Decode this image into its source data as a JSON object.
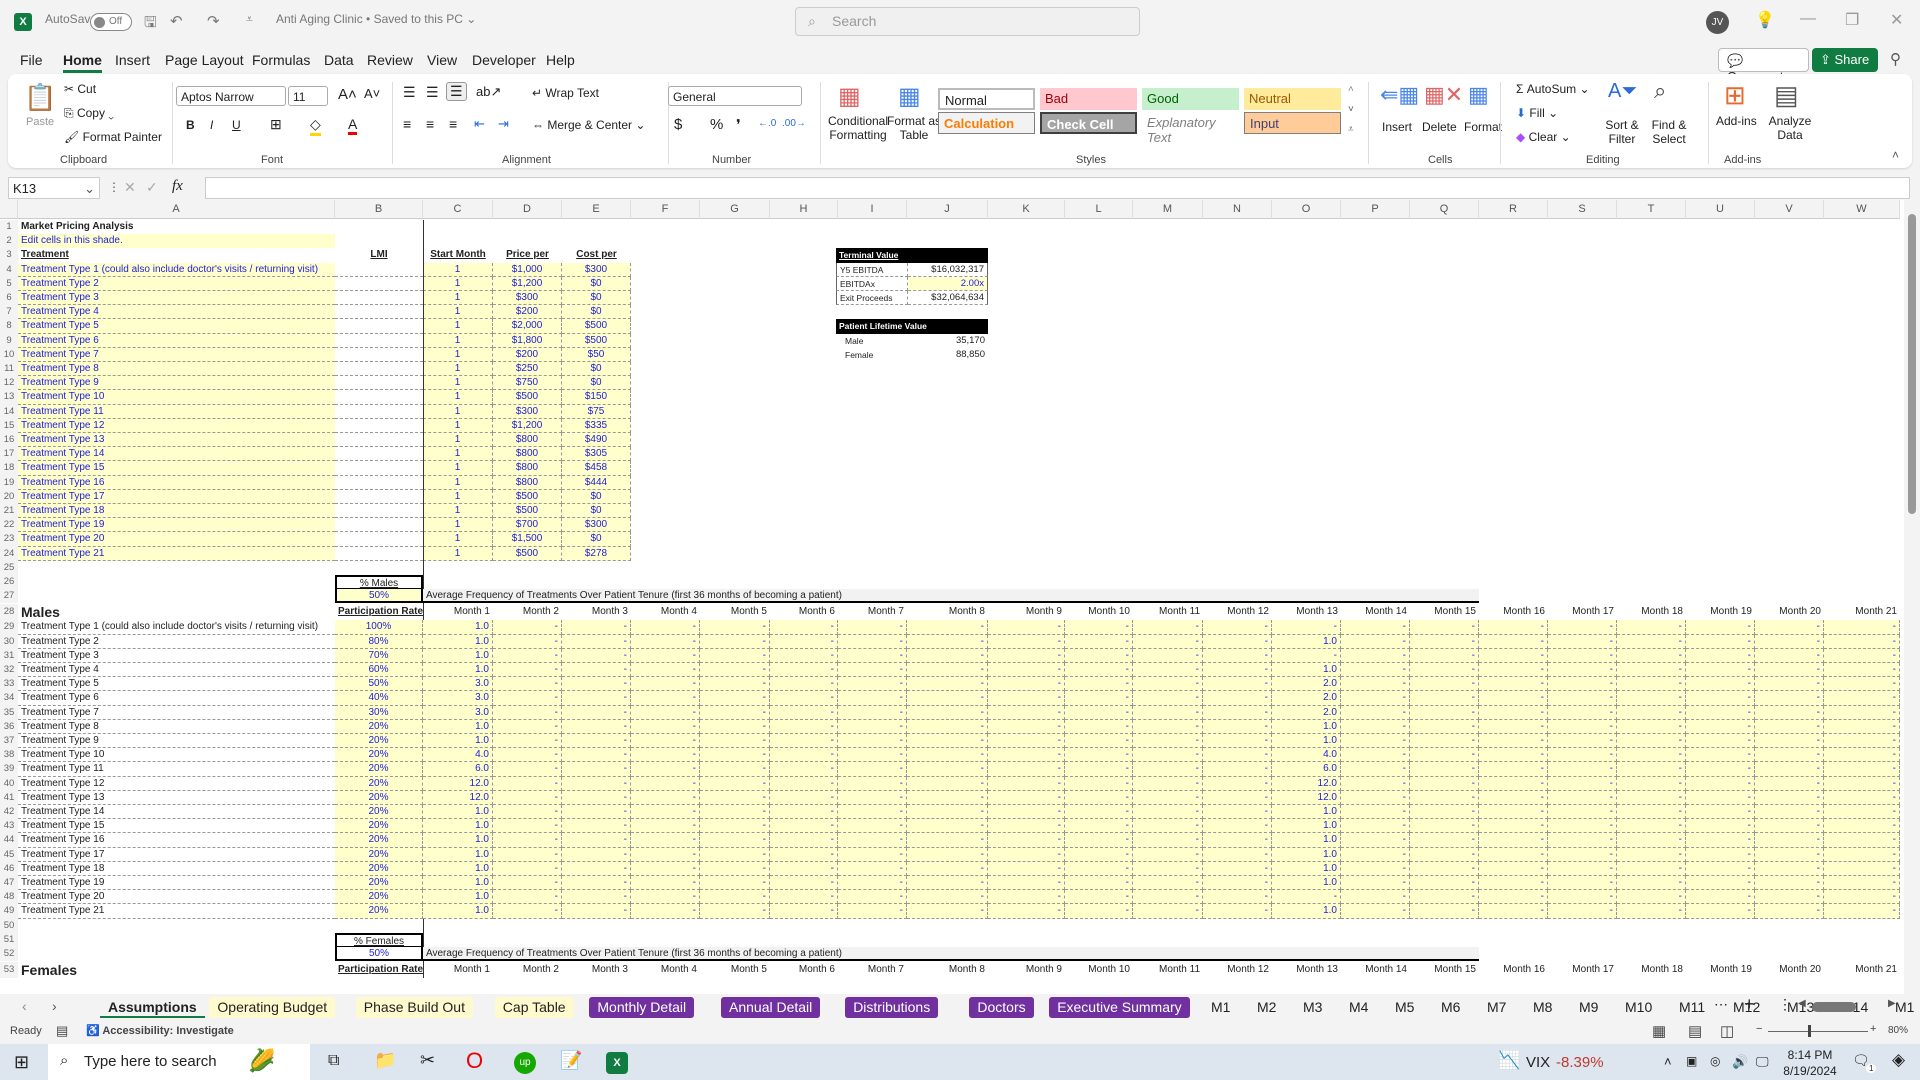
{
  "window": {
    "app_icon": "excel-icon",
    "autosave_label": "AutoSave",
    "autosave_state": "Off",
    "doc_title": "Anti Aging Clinic • Saved to this PC ⌄",
    "search_placeholder": "Search",
    "user_initials": "JV"
  },
  "menu": {
    "items": [
      "File",
      "Home",
      "Insert",
      "Page Layout",
      "Formulas",
      "Data",
      "Review",
      "View",
      "Developer",
      "Help"
    ],
    "active": "Home",
    "comments": "Comments",
    "share": "Share"
  },
  "ribbon": {
    "clipboard": {
      "paste": "Paste",
      "cut": "Cut",
      "copy": "Copy",
      "format_painter": "Format Painter",
      "label": "Clipboard"
    },
    "font": {
      "name": "Aptos Narrow",
      "size": "11",
      "label": "Font",
      "bold": "B",
      "italic": "I",
      "underline": "U"
    },
    "alignment": {
      "wrap": "Wrap Text",
      "merge": "Merge & Center",
      "label": "Alignment"
    },
    "number": {
      "format": "General",
      "label": "Number",
      "currency": "$",
      "percent": "%",
      "comma": "❜"
    },
    "styles": {
      "conditional": "Conditional Formatting",
      "format_table": "Format as Table",
      "cells": [
        {
          "name": "Normal",
          "bg": "#ffffff",
          "fg": "#222222"
        },
        {
          "name": "Bad",
          "bg": "#ffc7ce",
          "fg": "#9c0006"
        },
        {
          "name": "Good",
          "bg": "#c6efce",
          "fg": "#006100"
        },
        {
          "name": "Neutral",
          "bg": "#ffeb9c",
          "fg": "#9c5700"
        },
        {
          "name": "Calculation",
          "bg": "#f2f2f2",
          "fg": "#fa7d00"
        },
        {
          "name": "Check Cell",
          "bg": "#a5a5a5",
          "fg": "#ffffff"
        },
        {
          "name": "Explanatory Text",
          "bg": "#ffffff",
          "fg": "#7f7f7f"
        },
        {
          "name": "Input",
          "bg": "#ffcc99",
          "fg": "#3f3f76"
        }
      ],
      "label": "Styles"
    },
    "cells": {
      "insert": "Insert",
      "delete": "Delete",
      "format": "Format",
      "label": "Cells"
    },
    "editing": {
      "autosum": "AutoSum",
      "fill": "Fill",
      "clear": "Clear",
      "sort": "Sort & Filter",
      "find": "Find & Select",
      "label": "Editing"
    },
    "addins": {
      "addins": "Add-ins",
      "analyze": "Analyze Data",
      "label": "Add-ins"
    }
  },
  "formula_bar": {
    "name_box": "K13",
    "fx": "fx",
    "formula": ""
  },
  "columns": [
    "A",
    "B",
    "C",
    "D",
    "E",
    "F",
    "G",
    "H",
    "I",
    "J",
    "K",
    "L",
    "M",
    "N",
    "O",
    "P",
    "Q",
    "R",
    "S",
    "T",
    "U",
    "V",
    "W"
  ],
  "sheet": {
    "title": "Market Pricing Analysis",
    "edit_note": "Edit cells in this shade.",
    "pricing_headers": {
      "treatment": "Treatment",
      "lmi": "LMI",
      "start": "Start Month",
      "price": "Price per",
      "cost": "Cost per"
    },
    "pricing": [
      {
        "name": "Treatment Type 1 (could also include doctor's visits / returning visit)",
        "start": "1",
        "price": "$1,000",
        "cost": "$300"
      },
      {
        "name": "Treatment Type 2",
        "start": "1",
        "price": "$1,200",
        "cost": "$0"
      },
      {
        "name": "Treatment Type 3",
        "start": "1",
        "price": "$300",
        "cost": "$0"
      },
      {
        "name": "Treatment Type 4",
        "start": "1",
        "price": "$200",
        "cost": "$0"
      },
      {
        "name": "Treatment Type 5",
        "start": "1",
        "price": "$2,000",
        "cost": "$500"
      },
      {
        "name": "Treatment Type 6",
        "start": "1",
        "price": "$1,800",
        "cost": "$500"
      },
      {
        "name": "Treatment Type 7",
        "start": "1",
        "price": "$200",
        "cost": "$50"
      },
      {
        "name": "Treatment Type 8",
        "start": "1",
        "price": "$250",
        "cost": "$0"
      },
      {
        "name": "Treatment Type 9",
        "start": "1",
        "price": "$750",
        "cost": "$0"
      },
      {
        "name": "Treatment Type 10",
        "start": "1",
        "price": "$500",
        "cost": "$150"
      },
      {
        "name": "Treatment Type 11",
        "start": "1",
        "price": "$300",
        "cost": "$75"
      },
      {
        "name": "Treatment Type 12",
        "start": "1",
        "price": "$1,200",
        "cost": "$335"
      },
      {
        "name": "Treatment Type 13",
        "start": "1",
        "price": "$800",
        "cost": "$490"
      },
      {
        "name": "Treatment Type 14",
        "start": "1",
        "price": "$800",
        "cost": "$305"
      },
      {
        "name": "Treatment Type 15",
        "start": "1",
        "price": "$800",
        "cost": "$458"
      },
      {
        "name": "Treatment Type 16",
        "start": "1",
        "price": "$800",
        "cost": "$444"
      },
      {
        "name": "Treatment Type 17",
        "start": "1",
        "price": "$500",
        "cost": "$0"
      },
      {
        "name": "Treatment Type 18",
        "start": "1",
        "price": "$500",
        "cost": "$0"
      },
      {
        "name": "Treatment Type 19",
        "start": "1",
        "price": "$700",
        "cost": "$300"
      },
      {
        "name": "Treatment Type 20",
        "start": "1",
        "price": "$1,500",
        "cost": "$0"
      },
      {
        "name": "Treatment Type 21",
        "start": "1",
        "price": "$500",
        "cost": "$278"
      }
    ],
    "terminal": {
      "title": "Terminal Value",
      "rows": [
        {
          "label": "Y5 EBITDA",
          "value": "$16,032,317"
        },
        {
          "label": "EBITDAx",
          "value": "2.00x"
        },
        {
          "label": "Exit Proceeds",
          "value": "$32,064,634"
        }
      ]
    },
    "ltv": {
      "title": "Patient Lifetime Value",
      "rows": [
        {
          "label": "Male",
          "value": "35,170"
        },
        {
          "label": "Female",
          "value": "88,850"
        }
      ]
    },
    "males": {
      "pct_label": "% Males",
      "pct": "50%",
      "freq_title": "Average Frequency of Treatments Over Patient Tenure (first 36 months of becoming a patient)",
      "section": "Males",
      "rate_header": "Participation Rate",
      "months": [
        "Month 1",
        "Month 2",
        "Month 3",
        "Month 4",
        "Month 5",
        "Month 6",
        "Month 7",
        "Month 8",
        "Month 9",
        "Month 10",
        "Month 11",
        "Month 12",
        "Month 13",
        "Month 14",
        "Month 15",
        "Month 16",
        "Month 17",
        "Month 18",
        "Month 19",
        "Month 20",
        "Month 21"
      ],
      "rows": [
        {
          "name": "Treatment Type 1 (could also include doctor's visits / returning visit)",
          "rate": "100%",
          "m1": "1.0",
          "m13": "-"
        },
        {
          "name": "Treatment Type 2",
          "rate": "80%",
          "m1": "1.0",
          "m13": "1.0"
        },
        {
          "name": "Treatment Type 3",
          "rate": "70%",
          "m1": "1.0",
          "m13": "-"
        },
        {
          "name": "Treatment Type 4",
          "rate": "60%",
          "m1": "1.0",
          "m13": "1.0"
        },
        {
          "name": "Treatment Type 5",
          "rate": "50%",
          "m1": "3.0",
          "m13": "2.0"
        },
        {
          "name": "Treatment Type 6",
          "rate": "40%",
          "m1": "3.0",
          "m13": "2.0"
        },
        {
          "name": "Treatment Type 7",
          "rate": "30%",
          "m1": "3.0",
          "m13": "2.0"
        },
        {
          "name": "Treatment Type 8",
          "rate": "20%",
          "m1": "1.0",
          "m13": "1.0"
        },
        {
          "name": "Treatment Type 9",
          "rate": "20%",
          "m1": "1.0",
          "m13": "1.0"
        },
        {
          "name": "Treatment Type 10",
          "rate": "20%",
          "m1": "4.0",
          "m13": "4.0"
        },
        {
          "name": "Treatment Type 11",
          "rate": "20%",
          "m1": "6.0",
          "m13": "6.0"
        },
        {
          "name": "Treatment Type 12",
          "rate": "20%",
          "m1": "12.0",
          "m13": "12.0"
        },
        {
          "name": "Treatment Type 13",
          "rate": "20%",
          "m1": "12.0",
          "m13": "12.0"
        },
        {
          "name": "Treatment Type 14",
          "rate": "20%",
          "m1": "1.0",
          "m13": "1.0"
        },
        {
          "name": "Treatment Type 15",
          "rate": "20%",
          "m1": "1.0",
          "m13": "1.0"
        },
        {
          "name": "Treatment Type 16",
          "rate": "20%",
          "m1": "1.0",
          "m13": "1.0"
        },
        {
          "name": "Treatment Type 17",
          "rate": "20%",
          "m1": "1.0",
          "m13": "1.0"
        },
        {
          "name": "Treatment Type 18",
          "rate": "20%",
          "m1": "1.0",
          "m13": "1.0"
        },
        {
          "name": "Treatment Type 19",
          "rate": "20%",
          "m1": "1.0",
          "m13": "1.0"
        },
        {
          "name": "Treatment Type 20",
          "rate": "20%",
          "m1": "1.0",
          "m13": "-"
        },
        {
          "name": "Treatment Type 21",
          "rate": "20%",
          "m1": "1.0",
          "m13": "1.0"
        }
      ],
      "empty_value": "-"
    },
    "females": {
      "pct_label": "% Females",
      "pct": "50%",
      "freq_title": "Average Frequency of Treatments Over Patient Tenure (first 36 months of becoming a patient)",
      "section": "Females",
      "rate_header": "Participation Rate"
    }
  },
  "tabs": [
    {
      "label": "Assumptions",
      "style": "active"
    },
    {
      "label": "Operating Budget",
      "style": "yellow"
    },
    {
      "label": "Phase Build Out",
      "style": "yellow"
    },
    {
      "label": "Cap Table",
      "style": "yellow"
    },
    {
      "label": "Monthly Detail",
      "style": "purple"
    },
    {
      "label": "Annual Detail",
      "style": "purple"
    },
    {
      "label": "Distributions",
      "style": "purple"
    },
    {
      "label": "Doctors",
      "style": "purple"
    },
    {
      "label": "Executive Summary",
      "style": "purple"
    },
    {
      "label": "M1",
      "style": "plain"
    },
    {
      "label": "M2",
      "style": "plain"
    },
    {
      "label": "M3",
      "style": "plain"
    },
    {
      "label": "M4",
      "style": "plain"
    },
    {
      "label": "M5",
      "style": "plain"
    },
    {
      "label": "M6",
      "style": "plain"
    },
    {
      "label": "M7",
      "style": "plain"
    },
    {
      "label": "M8",
      "style": "plain"
    },
    {
      "label": "M9",
      "style": "plain"
    },
    {
      "label": "M10",
      "style": "plain"
    },
    {
      "label": "M11",
      "style": "plain"
    },
    {
      "label": "M12",
      "style": "plain"
    },
    {
      "label": "M13",
      "style": "plain"
    },
    {
      "label": "M14",
      "style": "plain"
    },
    {
      "label": "M1",
      "style": "plain"
    }
  ],
  "status": {
    "ready": "Ready",
    "accessibility": "Accessibility: Investigate",
    "zoom": "80%"
  },
  "taskbar": {
    "search_placeholder": "Type here to search",
    "vix_label": "VIX",
    "vix_change": "-8.39%",
    "time": "8:14 PM",
    "date": "8/19/2024",
    "notifications": "1"
  }
}
